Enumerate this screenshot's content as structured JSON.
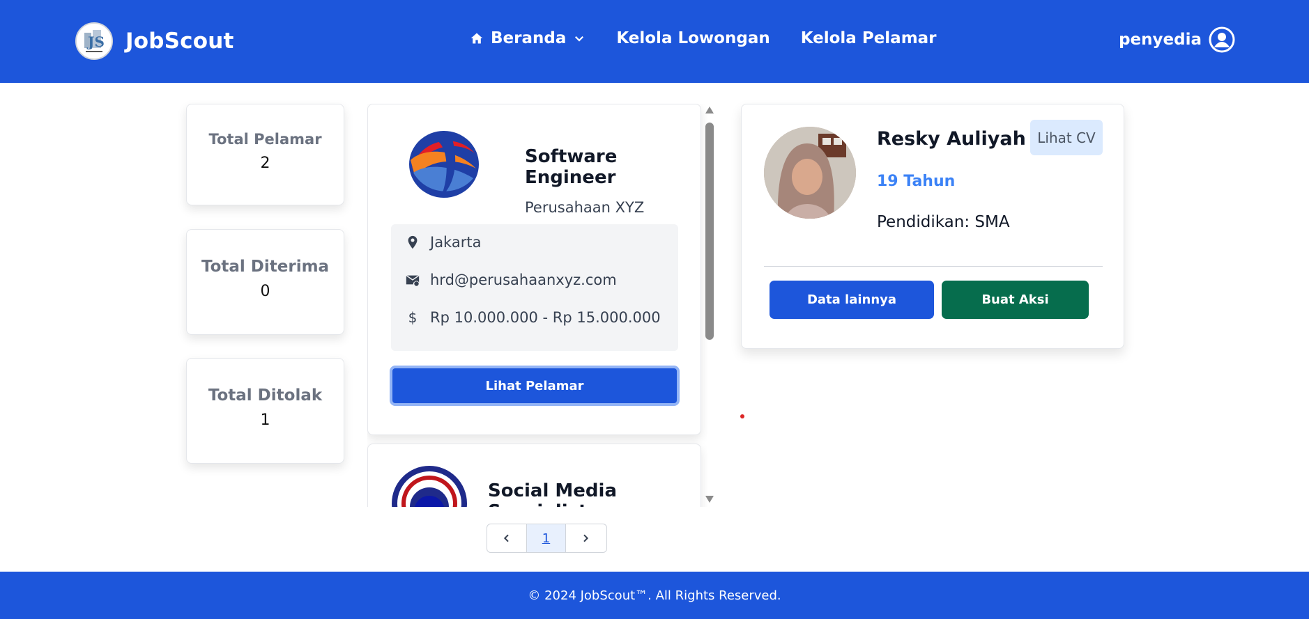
{
  "nav": {
    "brand": "JobScout",
    "links": {
      "home": "Beranda",
      "manage_jobs": "Kelola Lowongan",
      "manage_applicants": "Kelola Pelamar"
    },
    "user": "penyedia"
  },
  "stats": [
    {
      "title": "Total Pelamar",
      "value": "2"
    },
    {
      "title": "Total Diterima",
      "value": "0"
    },
    {
      "title": "Total Ditolak",
      "value": "1"
    }
  ],
  "jobs": [
    {
      "title": "Software Engineer",
      "company": "Perusahaan XYZ",
      "location": "Jakarta",
      "email": "hrd@perusahaanxyz.com",
      "salary": "Rp 10.000.000 - Rp 15.000.000",
      "button": "Lihat Pelamar"
    },
    {
      "title": "Social Media Specialist"
    }
  ],
  "applicant": {
    "name": "Resky Auliyah",
    "age": "19 Tahun",
    "education": "Pendidikan: SMA",
    "cv_button": "Lihat CV",
    "more_button": "Data lainnya",
    "action_button": "Buat Aksi"
  },
  "pagination": {
    "current": "1"
  },
  "footer": "© 2024 JobScout™. All Rights Reserved.",
  "colors": {
    "primary": "#1d56db",
    "success": "#066d4d",
    "accent_text": "#3b82f6",
    "cv_bg": "#dbeafe"
  },
  "icons": [
    "home-icon",
    "chevron-down-icon",
    "user-circle-icon",
    "location-pin-icon",
    "mail-icon",
    "dollar-icon",
    "chevron-left-icon",
    "chevron-right-icon",
    "scroll-up-icon",
    "scroll-down-icon"
  ]
}
